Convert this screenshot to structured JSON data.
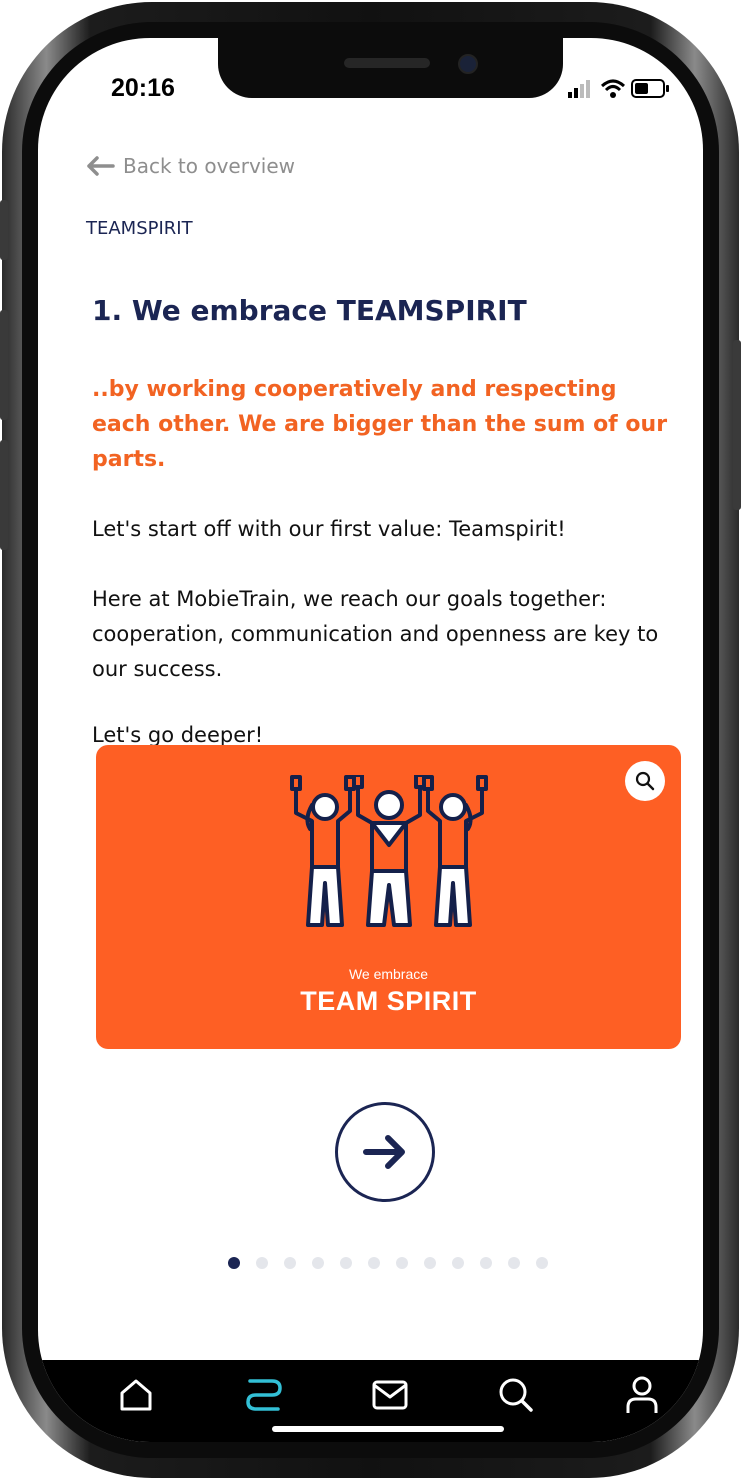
{
  "status_bar": {
    "time": "20:16"
  },
  "nav": {
    "back_label": "Back to overview"
  },
  "category": "TEAMSPIRIT",
  "lesson": {
    "title": "1. We embrace TEAMSPIRIT",
    "lead": "..by working cooperatively and respecting each other. We are bigger than the sum of our parts.",
    "paragraphs": [
      "Let's start off with our first value: Teamspirit!",
      "Here at MobieTrain, we reach our goals together: cooperation, communication and openness are key to our success.",
      "Let's go deeper!"
    ]
  },
  "banner": {
    "small_text": "We embrace",
    "big_text": "TEAM SPIRIT",
    "background": "#fe5f24",
    "icon": "three-people-arms-raised-illustration"
  },
  "pager": {
    "total": 12,
    "current": 1
  },
  "tabs": [
    {
      "name": "home",
      "icon": "home-icon",
      "active": false
    },
    {
      "name": "learning",
      "icon": "learning-path-icon",
      "active": true
    },
    {
      "name": "messages",
      "icon": "mail-icon",
      "active": false
    },
    {
      "name": "search",
      "icon": "search-icon",
      "active": false
    },
    {
      "name": "profile",
      "icon": "profile-icon",
      "active": false
    }
  ],
  "colors": {
    "navy": "#1b2553",
    "orange_text": "#f26322",
    "banner_orange": "#fe5f24",
    "tab_active": "#33c0d6",
    "back_gray": "#8e8e8e"
  }
}
